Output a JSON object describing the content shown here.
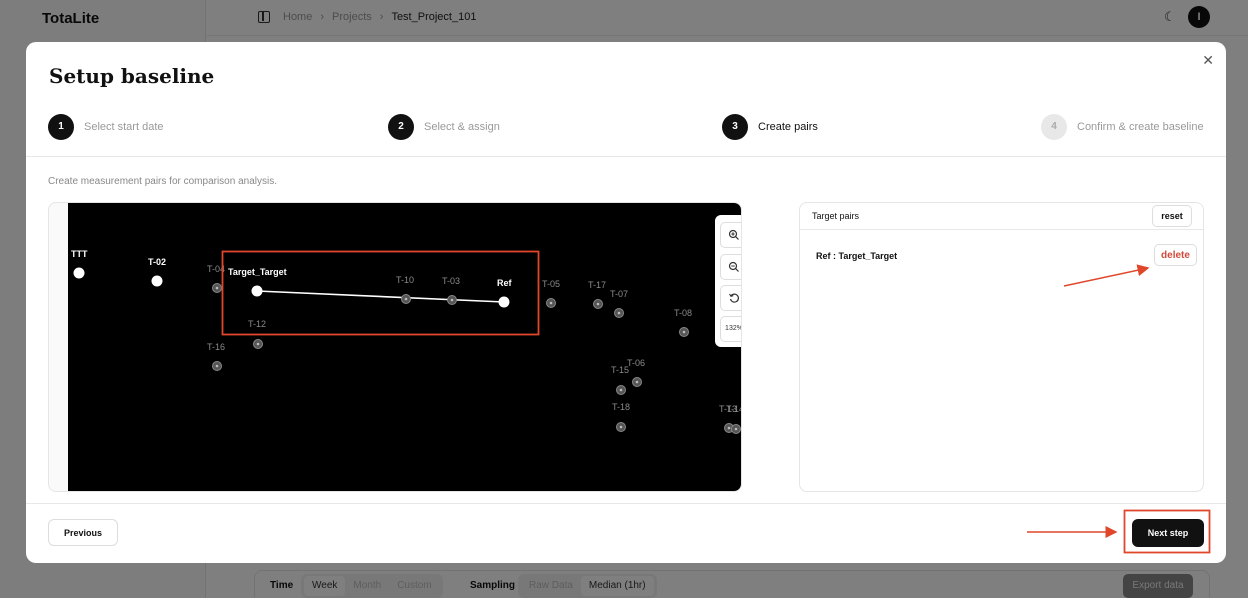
{
  "app": {
    "brand": "TotaLite",
    "breadcrumb": [
      "Home",
      "Projects",
      "Test_Project_101"
    ],
    "theme_icon": "moon-icon",
    "avatar_initial": "I"
  },
  "bottom_bar": {
    "time_label": "Time",
    "time_options": [
      "Week",
      "Month",
      "Custom"
    ],
    "time_selected": "Week",
    "sampling_label": "Sampling",
    "sampling_options": [
      "Raw Data",
      "Median (1hr)"
    ],
    "sampling_selected": "Median (1hr)",
    "export_label": "Export data"
  },
  "modal": {
    "title": "Setup baseline",
    "close_icon": "close-icon",
    "steps": [
      {
        "number": "1",
        "label": "Select start date",
        "status": "done"
      },
      {
        "number": "2",
        "label": "Select & assign",
        "status": "done"
      },
      {
        "number": "3",
        "label": "Create pairs",
        "status": "active"
      },
      {
        "number": "4",
        "label": "Confirm & create baseline",
        "status": "pending"
      }
    ],
    "description": "Create measurement pairs for comparison analysis.",
    "map": {
      "zoom_level": "132%",
      "controls": [
        "zoom-in-icon",
        "zoom-out-icon",
        "reset-view-icon"
      ],
      "points": [
        {
          "label": "TTT",
          "kind": "main"
        },
        {
          "label": "T-02",
          "kind": "main"
        },
        {
          "label": "T-04",
          "kind": "minor"
        },
        {
          "label": "Target_Target",
          "kind": "main"
        },
        {
          "label": "T-10",
          "kind": "minor"
        },
        {
          "label": "T-03",
          "kind": "minor"
        },
        {
          "label": "Ref",
          "kind": "main"
        },
        {
          "label": "T-12",
          "kind": "minor"
        },
        {
          "label": "T-16",
          "kind": "minor"
        },
        {
          "label": "T-05",
          "kind": "minor"
        },
        {
          "label": "T-17",
          "kind": "minor"
        },
        {
          "label": "T-07",
          "kind": "minor"
        },
        {
          "label": "T-08",
          "kind": "minor"
        },
        {
          "label": "T-06",
          "kind": "minor"
        },
        {
          "label": "T-15",
          "kind": "minor"
        },
        {
          "label": "T-18",
          "kind": "minor"
        },
        {
          "label": "T-13",
          "kind": "minor"
        },
        {
          "label": "T-14",
          "kind": "minor"
        }
      ],
      "pair_line": {
        "from": "Target_Target",
        "to": "Ref"
      }
    },
    "pairs": {
      "title": "Target pairs",
      "reset_label": "reset",
      "items": [
        {
          "label": "Ref : Target_Target",
          "delete_label": "delete"
        }
      ]
    },
    "footer": {
      "previous_label": "Previous",
      "next_label": "Next step"
    }
  },
  "colors": {
    "accent": "#111111",
    "danger": "#d24a3a",
    "annotation": "#e0462a"
  }
}
